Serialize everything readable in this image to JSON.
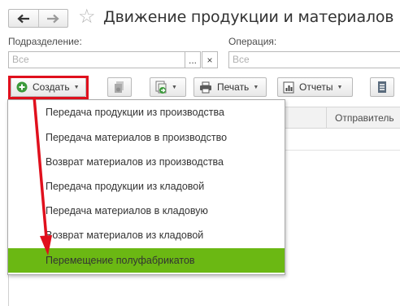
{
  "header": {
    "title": "Движение продукции и материалов",
    "back_icon": "arrow-left-icon",
    "forward_icon": "arrow-right-icon",
    "favorite_icon": "star-icon"
  },
  "filters": {
    "department": {
      "label": "Подразделение:",
      "placeholder": "Все",
      "select_button": "...",
      "clear_button": "×"
    },
    "operation": {
      "label": "Операция:",
      "placeholder": "Все"
    }
  },
  "toolbar": {
    "create_label": "Создать",
    "print_label": "Печать",
    "reports_label": "Отчеты"
  },
  "grid": {
    "columns": [
      "Отправитель"
    ]
  },
  "create_menu": {
    "items": [
      {
        "label": "Передача продукции из производства"
      },
      {
        "label": "Передача материалов в производство"
      },
      {
        "label": "Возврат материалов из производства"
      },
      {
        "label": "Передача продукции из кладовой"
      },
      {
        "label": "Передача материалов в кладовую"
      },
      {
        "label": "Возврат материалов из кладовой"
      },
      {
        "label": "Перемещение полуфабрикатов"
      }
    ],
    "selected_index": 6
  },
  "colors": {
    "highlight": "#e0101d",
    "selected_item": "#6bb813",
    "create_icon": "#3a9a3a"
  }
}
